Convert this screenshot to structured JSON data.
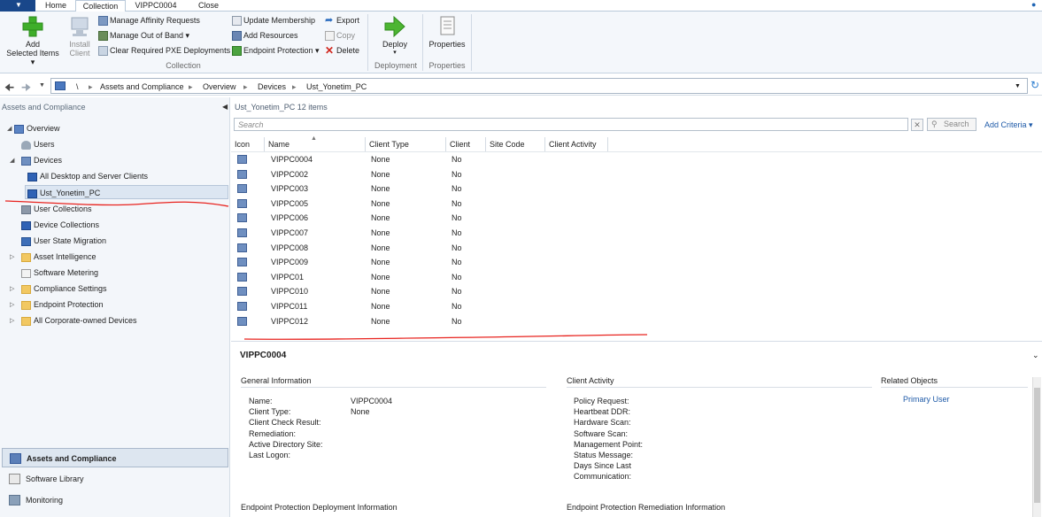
{
  "tabs": [
    "Home",
    "Collection",
    "VIPPC0004",
    "Close"
  ],
  "active_tab": "Collection",
  "ribbon": {
    "add_selected": [
      "Add",
      "Selected Items ▾"
    ],
    "install_client": [
      "Install",
      "Client"
    ],
    "manage_affinity": "Manage Affinity Requests",
    "manage_oob": "Manage Out of Band ▾",
    "clear_pxe": "Clear Required PXE Deployments",
    "update_membership": "Update Membership",
    "add_resources": "Add Resources",
    "endpoint_protection": "Endpoint Protection ▾",
    "export": "Export",
    "copy": "Copy",
    "delete": "Delete",
    "deploy": "Deploy",
    "deploy_arrow": "▾",
    "properties": "Properties",
    "group_collection": "Collection",
    "group_deployment": "Deployment",
    "group_properties": "Properties"
  },
  "address": {
    "root": "\\",
    "crumbs": [
      "Assets and Compliance",
      "Overview",
      "Devices",
      "Ust_Yonetim_PC"
    ],
    "sep": "▸"
  },
  "nav": {
    "header": "Assets and Compliance",
    "items": [
      {
        "label": "Overview"
      },
      {
        "label": "Users"
      },
      {
        "label": "Devices"
      },
      {
        "label": "All Desktop and Server Clients"
      },
      {
        "label": "Ust_Yonetim_PC"
      },
      {
        "label": "User Collections"
      },
      {
        "label": "Device Collections"
      },
      {
        "label": "User State Migration"
      },
      {
        "label": "Asset Intelligence"
      },
      {
        "label": "Software Metering"
      },
      {
        "label": "Compliance Settings"
      },
      {
        "label": "Endpoint Protection"
      },
      {
        "label": "All Corporate-owned Devices"
      }
    ],
    "workspaces": [
      "Assets and Compliance",
      "Software Library",
      "Monitoring"
    ]
  },
  "list": {
    "title": "Ust_Yonetim_PC",
    "count": "12 items",
    "search_placeholder": "Search",
    "search_button": "Search",
    "add_criteria": "Add Criteria ▾",
    "columns": [
      "Icon",
      "Name",
      "Client Type",
      "Client",
      "Site Code",
      "Client Activity"
    ],
    "rows": [
      {
        "name": "VIPPC0004",
        "type": "None",
        "client": "No"
      },
      {
        "name": "VIPPC002",
        "type": "None",
        "client": "No"
      },
      {
        "name": "VIPPC003",
        "type": "None",
        "client": "No"
      },
      {
        "name": "VIPPC005",
        "type": "None",
        "client": "No"
      },
      {
        "name": "VIPPC006",
        "type": "None",
        "client": "No"
      },
      {
        "name": "VIPPC007",
        "type": "None",
        "client": "No"
      },
      {
        "name": "VIPPC008",
        "type": "None",
        "client": "No"
      },
      {
        "name": "VIPPC009",
        "type": "None",
        "client": "No"
      },
      {
        "name": "VIPPC01",
        "type": "None",
        "client": "No"
      },
      {
        "name": "VIPPC010",
        "type": "None",
        "client": "No"
      },
      {
        "name": "VIPPC011",
        "type": "None",
        "client": "No"
      },
      {
        "name": "VIPPC012",
        "type": "None",
        "client": "No"
      }
    ]
  },
  "detail": {
    "title": "VIPPC0004",
    "general_title": "General Information",
    "general_keys": [
      "Name:",
      "Client Type:",
      "Client Check Result:",
      "Remediation:",
      "Active Directory Site:",
      "Last Logon:"
    ],
    "general_vals": [
      "VIPPC0004",
      "None"
    ],
    "activity_title": "Client Activity",
    "activity_keys": [
      "Policy Request:",
      "Heartbeat DDR:",
      "Hardware Scan:",
      "Software Scan:",
      "Management Point:",
      "Status Message:",
      "Days Since Last",
      "Communication:"
    ],
    "related_title": "Related Objects",
    "primary_user": "Primary User",
    "ep_deploy_title": "Endpoint Protection Deployment Information",
    "ep_remed_title": "Endpoint Protection Remediation Information"
  },
  "colors": {
    "accent": "#19478a",
    "link": "#1e5aa8",
    "annotation": "#e8231e"
  }
}
